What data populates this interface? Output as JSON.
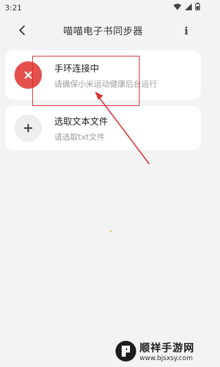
{
  "status_bar": {
    "time": "3:21",
    "icons": [
      "wifi-icon",
      "signal-icon",
      "battery-icon"
    ]
  },
  "app_bar": {
    "title": "喵喵电子书同步器",
    "back_icon": "chevron-left-icon",
    "info_label": "i"
  },
  "cards": {
    "connect": {
      "icon": "close-icon",
      "title": "手环连接中",
      "subtitle": "请确保小米运动健康后台运行"
    },
    "select": {
      "icon": "plus-icon",
      "title": "选取文本文件",
      "subtitle": "请选取txt文件"
    }
  },
  "watermark": {
    "name": "顺祥手游网",
    "url": "www.bjsxsy.com"
  },
  "colors": {
    "background": "#f3f3f3",
    "card": "#ffffff",
    "accent_red": "#e4514d",
    "annotation_red": "#d93030"
  }
}
